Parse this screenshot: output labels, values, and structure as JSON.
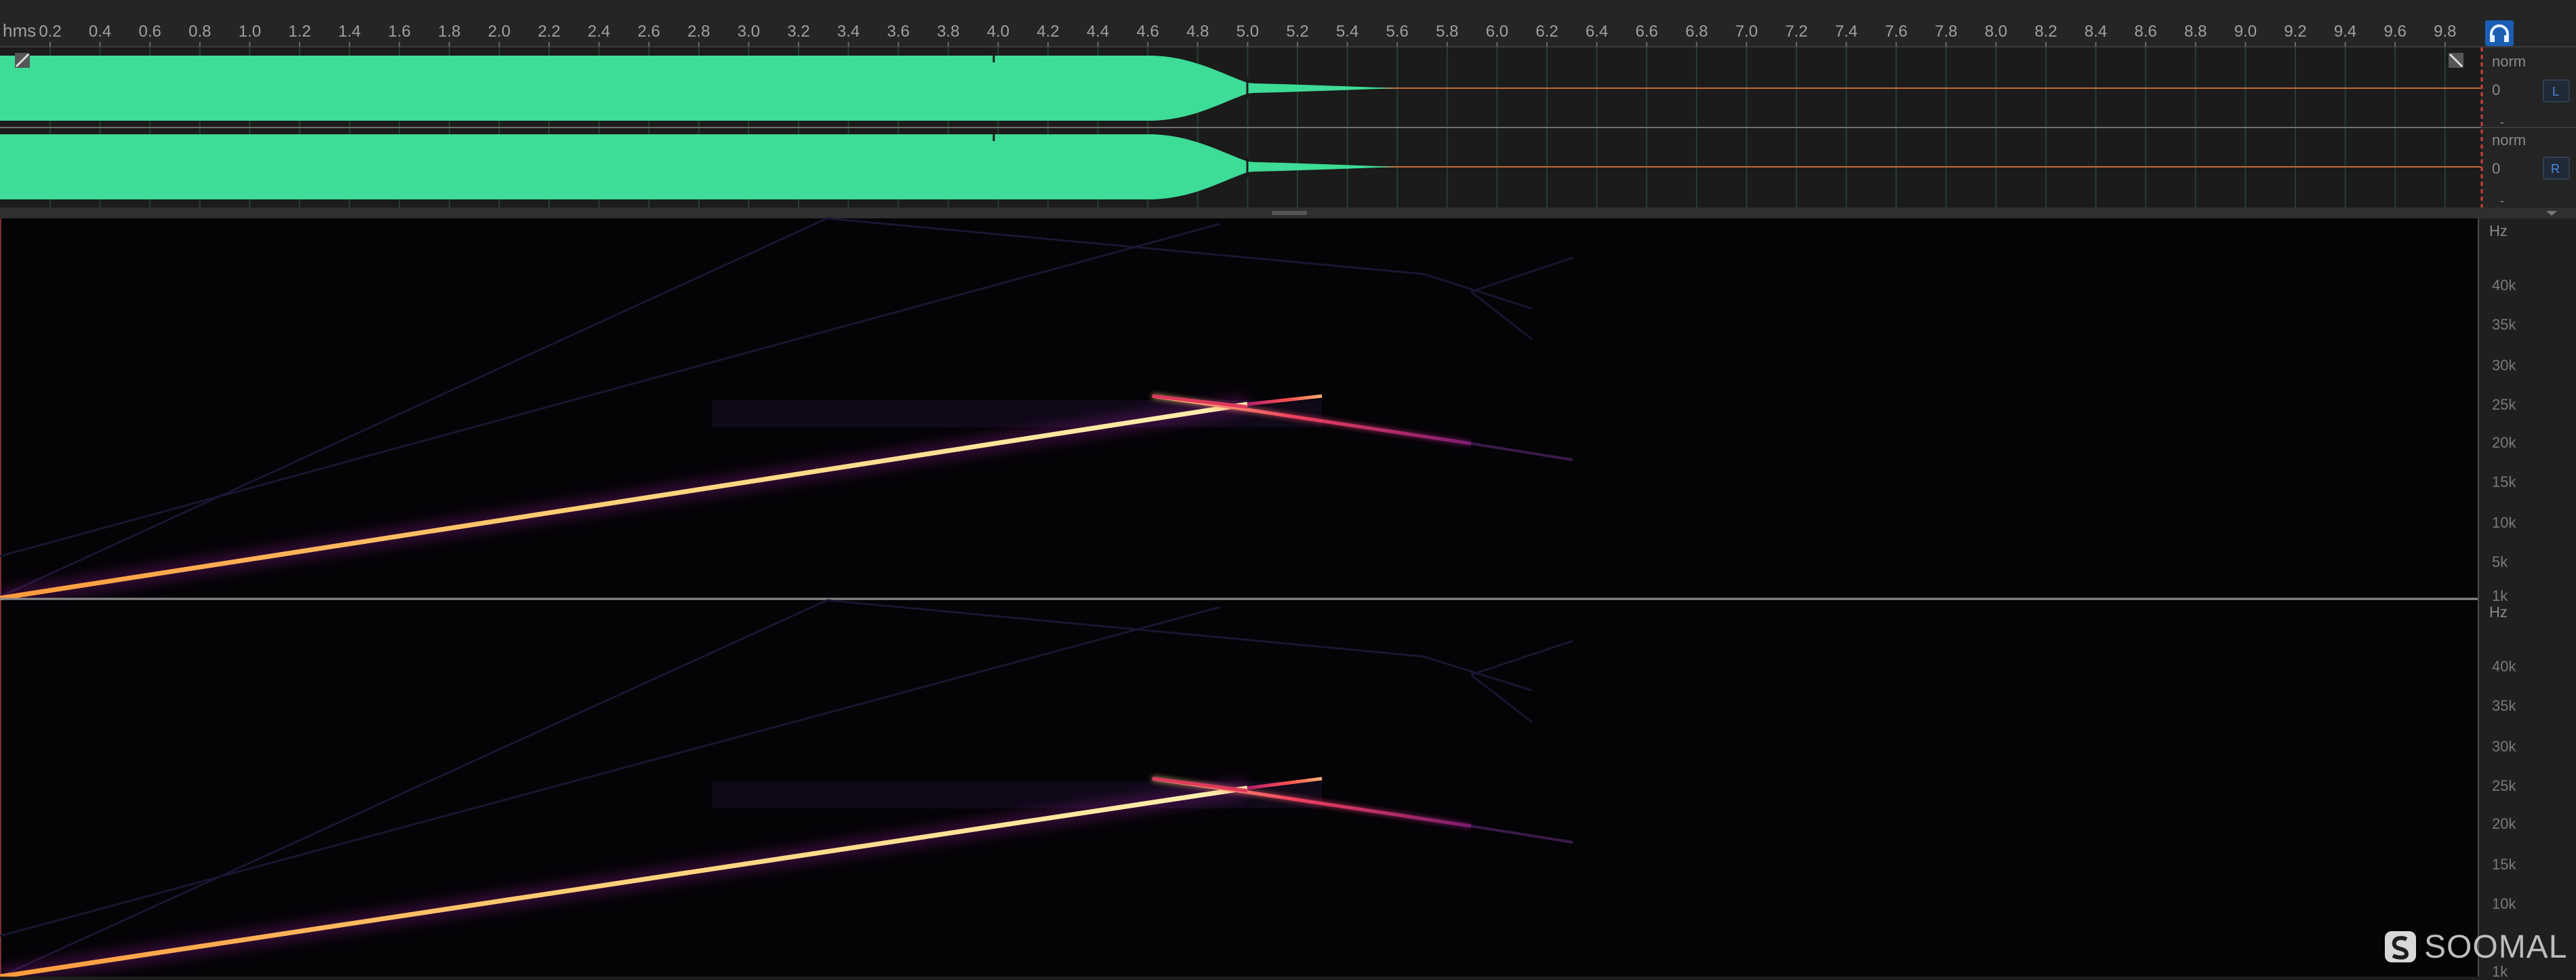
{
  "ruler": {
    "unit_label": "hms",
    "ticks": [
      "0.2",
      "0.4",
      "0.6",
      "0.8",
      "1.0",
      "1.2",
      "1.4",
      "1.6",
      "1.8",
      "2.0",
      "2.2",
      "2.4",
      "2.6",
      "2.8",
      "3.0",
      "3.2",
      "3.4",
      "3.6",
      "3.8",
      "4.0",
      "4.2",
      "4.4",
      "4.6",
      "4.8",
      "5.0",
      "5.2",
      "5.4",
      "5.6",
      "5.8",
      "6.0",
      "6.2",
      "6.4",
      "6.6",
      "6.8",
      "7.0",
      "7.2",
      "7.4",
      "7.6",
      "7.8",
      "8.0",
      "8.2",
      "8.4",
      "8.6",
      "8.8",
      "9.0",
      "9.2",
      "9.4",
      "9.6",
      "9.8"
    ],
    "playhead_icon": "headphones-icon"
  },
  "waveform": {
    "color": "#3ddc97",
    "channels": [
      {
        "norm_label": "norm",
        "zero_label": "0",
        "bottom_label": "-",
        "channel_button": "L"
      },
      {
        "norm_label": "norm",
        "zero_label": "0",
        "bottom_label": "-",
        "channel_button": "R"
      }
    ]
  },
  "spectrogram": {
    "colormap": [
      "#000000",
      "#3a0a5e",
      "#a0207a",
      "#f04060",
      "#ffd27a"
    ],
    "channels": [
      {
        "hz_label": "Hz",
        "freq_labels": [
          "40k",
          "35k",
          "30k",
          "25k",
          "20k",
          "15k",
          "10k",
          "5k",
          "1k"
        ]
      },
      {
        "hz_label": "Hz",
        "freq_labels": [
          "40k",
          "35k",
          "30k",
          "25k",
          "20k",
          "15k",
          "10k",
          "1k"
        ]
      }
    ]
  },
  "watermark": {
    "text": "SOOMAL",
    "logo_icon": "soomal-logo-icon"
  }
}
